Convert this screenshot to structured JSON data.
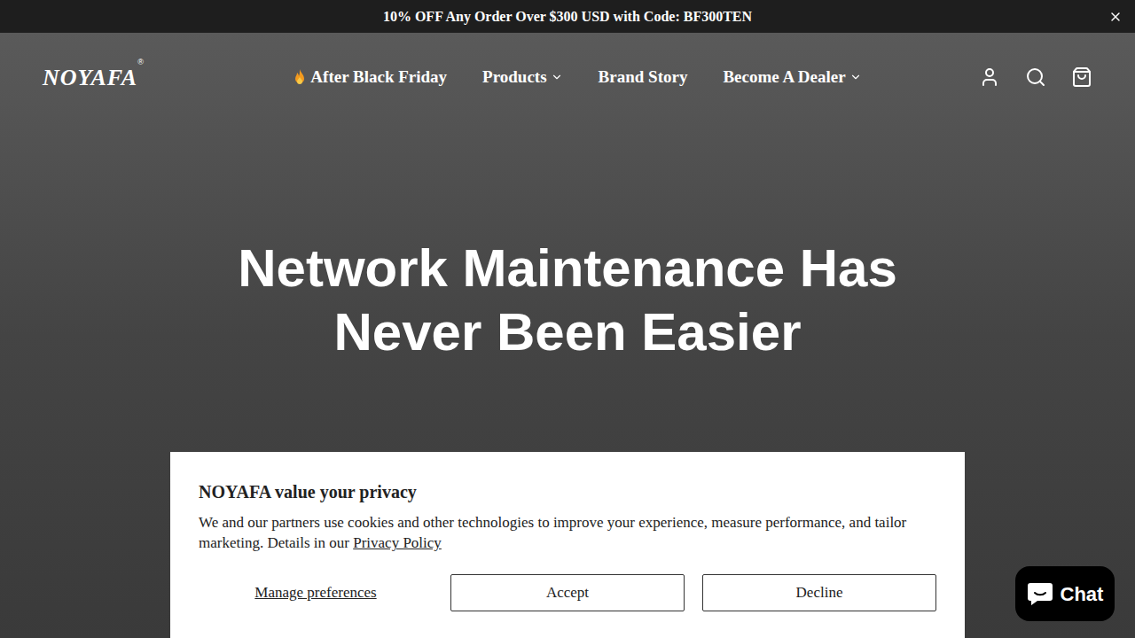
{
  "announcement": {
    "text": "10% OFF Any Order Over $300 USD with Code: BF300TEN"
  },
  "logo": {
    "text": "NOYAFA",
    "mark": "®"
  },
  "nav": [
    {
      "label": "After Black Friday",
      "dropdown": false,
      "flame": true
    },
    {
      "label": "Products",
      "dropdown": true,
      "flame": false
    },
    {
      "label": "Brand Story",
      "dropdown": false,
      "flame": false
    },
    {
      "label": "Become A Dealer",
      "dropdown": true,
      "flame": false
    }
  ],
  "hero": {
    "lines": [
      "Network Maintenance Has",
      "Never Been Easier"
    ]
  },
  "cookie_banner": {
    "title": "NOYAFA value your privacy",
    "body": "We and our partners use cookies and other technologies to improve your experience, measure performance, and tailor marketing. Details in our",
    "link": "Privacy Policy",
    "buttons": [
      {
        "label": "Manage preferences",
        "kind": "link"
      },
      {
        "label": "Accept",
        "kind": "outline"
      },
      {
        "label": "Decline",
        "kind": "outline"
      }
    ]
  },
  "chat": {
    "label": "Chat"
  }
}
